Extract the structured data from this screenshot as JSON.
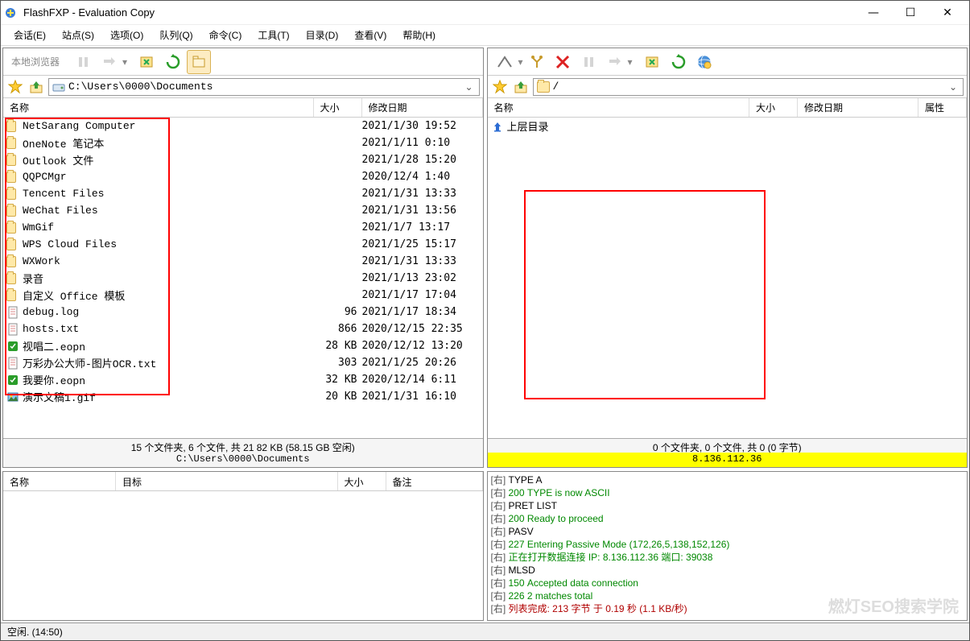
{
  "title": "FlashFXP - Evaluation Copy",
  "menus": [
    "会话(E)",
    "站点(S)",
    "选项(O)",
    "队列(Q)",
    "命令(C)",
    "工具(T)",
    "目录(D)",
    "查看(V)",
    "帮助(H)"
  ],
  "left": {
    "label": "本地浏览器",
    "path": "C:\\Users\\0000\\Documents",
    "cols": {
      "name": "名称",
      "size": "大小",
      "date": "修改日期"
    },
    "rows": [
      {
        "t": "d",
        "n": "NetSarang Computer",
        "s": "",
        "d": "2021/1/30 19:52"
      },
      {
        "t": "d",
        "n": "OneNote 笔记本",
        "s": "",
        "d": "2021/1/11 0:10"
      },
      {
        "t": "d",
        "n": "Outlook 文件",
        "s": "",
        "d": "2021/1/28 15:20"
      },
      {
        "t": "d",
        "n": "QQPCMgr",
        "s": "",
        "d": "2020/12/4 1:40"
      },
      {
        "t": "d",
        "n": "Tencent Files",
        "s": "",
        "d": "2021/1/31 13:33"
      },
      {
        "t": "d",
        "n": "WeChat Files",
        "s": "",
        "d": "2021/1/31 13:56"
      },
      {
        "t": "d",
        "n": "WmGif",
        "s": "",
        "d": "2021/1/7 13:17"
      },
      {
        "t": "d",
        "n": "WPS Cloud Files",
        "s": "",
        "d": "2021/1/25 15:17"
      },
      {
        "t": "d",
        "n": "WXWork",
        "s": "",
        "d": "2021/1/31 13:33"
      },
      {
        "t": "d",
        "n": "录音",
        "s": "",
        "d": "2021/1/13 23:02"
      },
      {
        "t": "d",
        "n": "自定义 Office 模板",
        "s": "",
        "d": "2021/1/17 17:04"
      },
      {
        "t": "f",
        "n": "debug.log",
        "s": "96",
        "d": "2021/1/17 18:34"
      },
      {
        "t": "f",
        "n": "hosts.txt",
        "s": "866",
        "d": "2020/12/15 22:35"
      },
      {
        "t": "e",
        "n": "视唱二.eopn",
        "s": "28 KB",
        "d": "2020/12/12 13:20"
      },
      {
        "t": "f",
        "n": "万彩办公大师-图片OCR.txt",
        "s": "303",
        "d": "2021/1/25 20:26"
      },
      {
        "t": "e",
        "n": "我要你.eopn",
        "s": "32 KB",
        "d": "2020/12/14 6:11"
      },
      {
        "t": "g",
        "n": "演示文稿1.gif",
        "s": "20 KB",
        "d": "2021/1/31 16:10"
      }
    ],
    "status": "15 个文件夹, 6 个文件, 共 21 82 KB (58.15 GB 空闲)",
    "status2": "C:\\Users\\0000\\Documents"
  },
  "right": {
    "path": "/",
    "cols": {
      "name": "名称",
      "size": "大小",
      "date": "修改日期",
      "attr": "属性"
    },
    "parent": "上层目录",
    "status": "0 个文件夹, 0 个文件, 共 0 (0 字节)",
    "status2": "8.136.112.36"
  },
  "queue": {
    "cols": {
      "name": "名称",
      "target": "目标",
      "size": "大小",
      "note": "备注"
    }
  },
  "log": [
    {
      "c": "blk",
      "t": "[右] TYPE A"
    },
    {
      "c": "grn",
      "t": "[右] 200 TYPE is now ASCII"
    },
    {
      "c": "blk",
      "t": "[右] PRET LIST"
    },
    {
      "c": "grn",
      "t": "[右] 200 Ready to proceed"
    },
    {
      "c": "blk",
      "t": "[右] PASV"
    },
    {
      "c": "grn",
      "t": "[右] 227 Entering Passive Mode (172,26,5,138,152,126)"
    },
    {
      "c": "grn",
      "t": "[右] 正在打开数据连接 IP: 8.136.112.36 端口: 39038"
    },
    {
      "c": "blk",
      "t": "[右] MLSD"
    },
    {
      "c": "grn",
      "t": "[右] 150 Accepted data connection"
    },
    {
      "c": "grn",
      "t": "[右] 226 2 matches total"
    },
    {
      "c": "red",
      "t": "[右] 列表完成: 213 字节 于 0.19 秒 (1.1 KB/秒)"
    }
  ],
  "statusbar": "空闲. (14:50)",
  "watermark": "燃灯SEO搜索学院"
}
